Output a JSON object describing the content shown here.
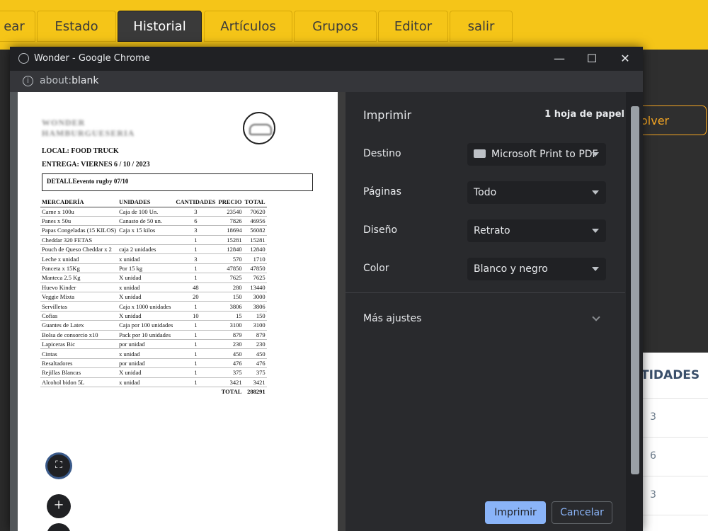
{
  "nav": {
    "tabs": [
      {
        "label": "ear"
      },
      {
        "label": "Estado"
      },
      {
        "label": "Historial"
      },
      {
        "label": "Artículos"
      },
      {
        "label": "Grupos"
      },
      {
        "label": "Editor"
      },
      {
        "label": "salir"
      }
    ],
    "active_tab": "Historial"
  },
  "background_page": {
    "volver_label": "olver",
    "column_header": "TIDADES",
    "cells": [
      "3",
      "6",
      "3"
    ]
  },
  "window": {
    "title": "Wonder - Google Chrome",
    "minimize": "—",
    "maximize": "☐",
    "close": "✕",
    "url_prefix": "about:",
    "url_host": "blank"
  },
  "document": {
    "brand_line1": "WONDER",
    "brand_line2": "HAMBURGUESERIA",
    "local": "LOCAL: FOOD TRUCK",
    "entrega": "ENTREGA: VIERNES 6 / 10 / 2023",
    "detalle_label": "DETALLE",
    "detalle_value": "evento rugby 07/10",
    "headers": [
      "MERCADERÍA",
      "UNIDADES",
      "CANTIDADES",
      "PRECIO",
      "TOTAL"
    ],
    "rows": [
      [
        "Carne x 100u",
        "Caja de 100 Un.",
        "3",
        "23540",
        "70620"
      ],
      [
        "Panes x 50u",
        "Canasto de 50 un.",
        "6",
        "7826",
        "46956"
      ],
      [
        "Papas Congeladas (15 KILOS)",
        "Caja x 15 kilos",
        "3",
        "18694",
        "56082"
      ],
      [
        "Cheddar 320 FETAS",
        "",
        "1",
        "15281",
        "15281"
      ],
      [
        "Pouch de Queso Cheddar x 2",
        "caja 2 unidades",
        "1",
        "12840",
        "12840"
      ],
      [
        "Leche x unidad",
        "x unidad",
        "3",
        "570",
        "1710"
      ],
      [
        "Panceta x 15Kg",
        "Por 15 kg",
        "1",
        "47850",
        "47850"
      ],
      [
        "Manteca 2.5 Kg",
        "X unidad",
        "1",
        "7625",
        "7625"
      ],
      [
        "Huevo Kinder",
        "x unidad",
        "48",
        "280",
        "13440"
      ],
      [
        "Veggie Mixta",
        "X unidad",
        "20",
        "150",
        "3000"
      ],
      [
        "Servilletas",
        "Caja x 1000 unidades",
        "1",
        "3806",
        "3806"
      ],
      [
        "Cofias",
        "X unidad",
        "10",
        "15",
        "150"
      ],
      [
        "Guantes de Latex",
        "Caja por 100 unidades",
        "1",
        "3100",
        "3100"
      ],
      [
        "Bolsa de consorcio x10",
        "Pack por 10 unidades",
        "1",
        "879",
        "879"
      ],
      [
        "Lapiceras Bic",
        "por unidad",
        "1",
        "230",
        "230"
      ],
      [
        "Cintas",
        "x unidad",
        "1",
        "450",
        "450"
      ],
      [
        "Resaltadores",
        "por unidad",
        "1",
        "476",
        "476"
      ],
      [
        "Rejillas Blancas",
        "X unidad",
        "1",
        "375",
        "375"
      ],
      [
        "Alcohol bidon 5L",
        "x unidad",
        "1",
        "3421",
        "3421"
      ]
    ],
    "total_label": "TOTAL",
    "total_value": "288291"
  },
  "print_dialog": {
    "title": "Imprimir",
    "sheets": "1 hoja de papel",
    "destino_label": "Destino",
    "destino_value": "Microsoft Print to PDF",
    "paginas_label": "Páginas",
    "paginas_value": "Todo",
    "diseno_label": "Diseño",
    "diseno_value": "Retrato",
    "color_label": "Color",
    "color_value": "Blanco y negro",
    "mas_ajustes": "Más ajustes",
    "print_button": "Imprimir",
    "cancel_button": "Cancelar"
  },
  "preview_controls": {
    "zoom_in": "+",
    "zoom_out": "−",
    "fit": "⛶"
  },
  "colors": {
    "nav_yellow": "#f5c518",
    "accent_orange": "#f5a623",
    "chrome_dark": "#202124",
    "button_blue": "#8ab4f8"
  }
}
